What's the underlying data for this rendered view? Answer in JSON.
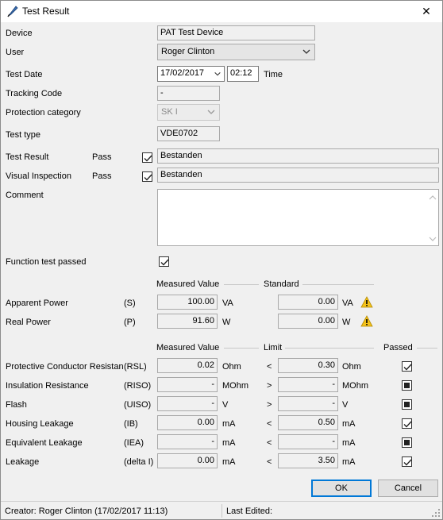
{
  "window": {
    "title": "Test Result",
    "close_glyph": "✕"
  },
  "form": {
    "device_label": "Device",
    "device_value": "PAT Test Device",
    "user_label": "User",
    "user_value": "Roger Clinton",
    "test_date_label": "Test Date",
    "test_date_value": "17/02/2017",
    "test_time_value": "02:12",
    "time_label": "Time",
    "tracking_label": "Tracking Code",
    "tracking_value": "-",
    "protection_label": "Protection category",
    "protection_value": "SK I",
    "test_type_label": "Test type",
    "test_type_value": "VDE0702",
    "test_result_label": "Test Result",
    "test_result_pass": "Pass",
    "test_result_text": "Bestanden",
    "visual_label": "Visual Inspection",
    "visual_pass": "Pass",
    "visual_text": "Bestanden",
    "comment_label": "Comment",
    "comment_value": "",
    "function_label": "Function test passed"
  },
  "power": {
    "measured_header": "Measured Value",
    "standard_header": "Standard",
    "rows": [
      {
        "name": "Apparent Power",
        "symbol": "(S)",
        "value": "100.00",
        "unit": "VA",
        "std_value": "0.00",
        "std_unit": "VA"
      },
      {
        "name": "Real Power",
        "symbol": "(P)",
        "value": "91.60",
        "unit": "W",
        "std_value": "0.00",
        "std_unit": "W"
      }
    ]
  },
  "measurements": {
    "measured_header": "Measured Value",
    "limit_header": "Limit",
    "passed_header": "Passed",
    "rows": [
      {
        "name": "Protective Conductor Resistanc",
        "symbol": "(RSL)",
        "value": "0.02",
        "unit": "Ohm",
        "op": "<",
        "limit": "0.30",
        "limit_unit": "Ohm",
        "passed": "checked"
      },
      {
        "name": "Insulation Resistance",
        "symbol": "(RISO)",
        "value": "-",
        "unit": "MOhm",
        "op": ">",
        "limit": "-",
        "limit_unit": "MOhm",
        "passed": "indeterminate"
      },
      {
        "name": "Flash",
        "symbol": "(UISO)",
        "value": "-",
        "unit": "V",
        "op": ">",
        "limit": "-",
        "limit_unit": "V",
        "passed": "indeterminate"
      },
      {
        "name": "Housing Leakage",
        "symbol": "(IB)",
        "value": "0.00",
        "unit": "mA",
        "op": "<",
        "limit": "0.50",
        "limit_unit": "mA",
        "passed": "checked"
      },
      {
        "name": "Equivalent Leakage",
        "symbol": "(IEA)",
        "value": "-",
        "unit": "mA",
        "op": "<",
        "limit": "-",
        "limit_unit": "mA",
        "passed": "indeterminate"
      },
      {
        "name": "Leakage",
        "symbol": "(delta I)",
        "value": "0.00",
        "unit": "mA",
        "op": "<",
        "limit": "3.50",
        "limit_unit": "mA",
        "passed": "checked"
      }
    ]
  },
  "buttons": {
    "ok": "OK",
    "cancel": "Cancel"
  },
  "status": {
    "creator": "Creator: Roger Clinton (17/02/2017 11:13)",
    "last_edited": "Last Edited:"
  }
}
